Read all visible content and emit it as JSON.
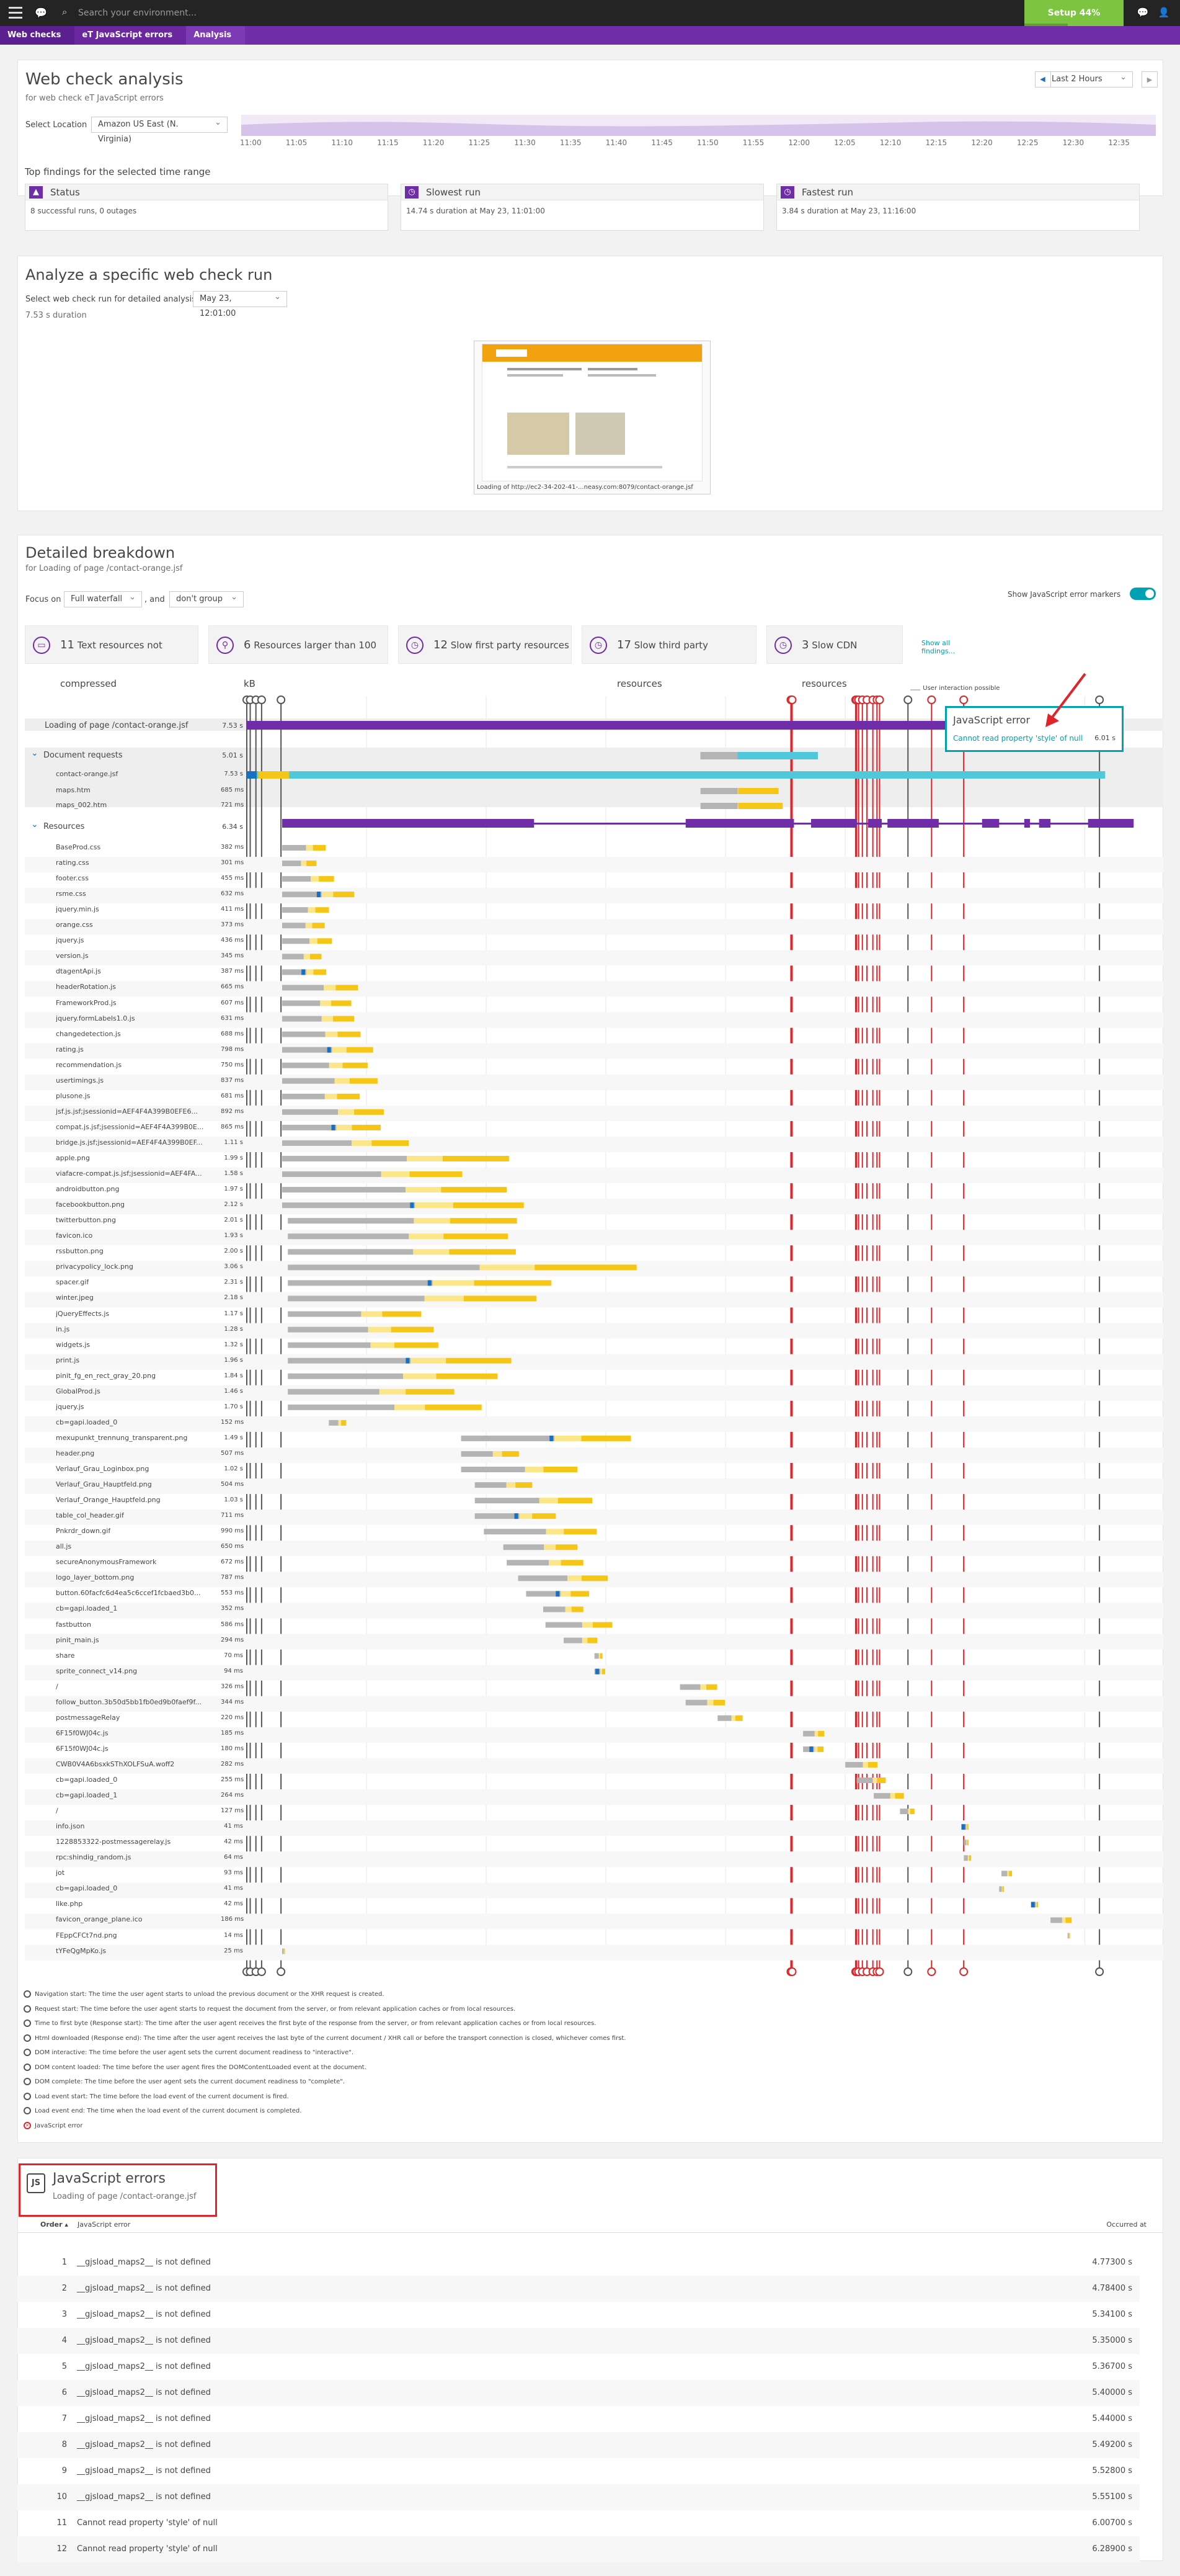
{
  "topbar": {
    "search_placeholder": "Search your environment...",
    "setup_label": "Setup 44% complete",
    "setup_progress": 0.44
  },
  "breadcrumb": [
    "Web checks",
    "eT JavaScript errors",
    "Analysis"
  ],
  "analysis": {
    "title": "Web check analysis",
    "subtitle": "for web check eT JavaScript errors",
    "location_label": "Select Location",
    "location_value": "Amazon US East (N. Virginia)",
    "timeframe": "Last 2 Hours",
    "ticks": [
      "11:00",
      "11:05",
      "11:10",
      "11:15",
      "11:20",
      "11:25",
      "11:30",
      "11:35",
      "11:40",
      "11:45",
      "11:50",
      "11:55",
      "12:00",
      "12:05",
      "12:10",
      "12:15",
      "12:20",
      "12:25",
      "12:30",
      "12:35"
    ]
  },
  "findings": {
    "title": "Top findings for the selected time range",
    "cards": [
      {
        "title": "Status",
        "body": "8 successful runs, 0 outages"
      },
      {
        "title": "Slowest run",
        "body": "14.74 s duration at May 23, 11:01:00"
      },
      {
        "title": "Fastest run",
        "body": "3.84 s duration at May 23, 11:16:00"
      }
    ]
  },
  "run": {
    "title": "Analyze a specific web check run",
    "select_label": "Select web check run for detailed analysis",
    "select_value": "May 23, 12:01:00",
    "duration": "7.53 s duration",
    "thumb_caption": "Loading of http://ec2-34-202-41-...neasy.com:8079/contact-orange.jsf"
  },
  "breakdown": {
    "title": "Detailed breakdown",
    "subtitle": "for Loading of page /contact-orange.jsf",
    "focus_label": "Focus on",
    "focus_value": "Full waterfall",
    "and_label": ", and",
    "group_value": "don't group",
    "show_js_markers": "Show JavaScript error markers",
    "chips": [
      {
        "count": "11",
        "text": "Text resources not compressed"
      },
      {
        "count": "6",
        "text": "Resources larger than 100 kB"
      },
      {
        "count": "12",
        "text": "Slow first party resources"
      },
      {
        "count": "17",
        "text": "Slow third party resources"
      },
      {
        "count": "3",
        "text": "Slow CDN resources"
      }
    ],
    "show_all": "Show all findings...",
    "user_interaction": "User interaction possible",
    "callout": {
      "title": "JavaScript error",
      "message": "Cannot read property 'style' of null",
      "time": "6.01 s"
    },
    "page_row": {
      "name": "Loading of page /contact-orange.jsf",
      "time": "7.53 s"
    },
    "doc_group": {
      "name": "Document requests",
      "time": "5.01 s"
    },
    "docs": [
      {
        "name": "contact-orange.jsf",
        "time": "7.53 s"
      },
      {
        "name": "maps.htm",
        "time": "685 ms"
      },
      {
        "name": "maps_002.htm",
        "time": "721 ms"
      }
    ],
    "res_group": {
      "name": "Resources",
      "time": "6.34 s"
    },
    "resources": [
      [
        "BaseProd.css",
        "382 ms"
      ],
      [
        "rating.css",
        "301 ms"
      ],
      [
        "footer.css",
        "455 ms"
      ],
      [
        "rsme.css",
        "632 ms"
      ],
      [
        "jquery.min.js",
        "411 ms"
      ],
      [
        "orange.css",
        "373 ms"
      ],
      [
        "jquery.js",
        "436 ms"
      ],
      [
        "version.js",
        "345 ms"
      ],
      [
        "dtagentApi.js",
        "387 ms"
      ],
      [
        "headerRotation.js",
        "665 ms"
      ],
      [
        "FrameworkProd.js",
        "607 ms"
      ],
      [
        "jquery.formLabels1.0.js",
        "631 ms"
      ],
      [
        "changedetection.js",
        "688 ms"
      ],
      [
        "rating.js",
        "798 ms"
      ],
      [
        "recommendation.js",
        "750 ms"
      ],
      [
        "usertimings.js",
        "837 ms"
      ],
      [
        "plusone.js",
        "681 ms"
      ],
      [
        "jsf.js.jsf;jsessionid=AEF4F4A399B0EFE6...",
        "892 ms"
      ],
      [
        "compat.js.jsf;jsessionid=AEF4F4A399B0E...",
        "865 ms"
      ],
      [
        "bridge.js.jsf;jsessionid=AEF4F4A399B0EF...",
        "1.11 s"
      ],
      [
        "apple.png",
        "1.99 s"
      ],
      [
        "viafacre-compat.js.jsf;jsessionid=AEF4FA...",
        "1.58 s"
      ],
      [
        "androidbutton.png",
        "1.97 s"
      ],
      [
        "facebookbutton.png",
        "2.12 s"
      ],
      [
        "twitterbutton.png",
        "2.01 s"
      ],
      [
        "favicon.ico",
        "1.93 s"
      ],
      [
        "rssbutton.png",
        "2.00 s"
      ],
      [
        "privacypolicy_lock.png",
        "3.06 s"
      ],
      [
        "spacer.gif",
        "2.31 s"
      ],
      [
        "winter.jpeg",
        "2.18 s"
      ],
      [
        "jQueryEffects.js",
        "1.17 s"
      ],
      [
        "in.js",
        "1.28 s"
      ],
      [
        "widgets.js",
        "1.32 s"
      ],
      [
        "print.js",
        "1.96 s"
      ],
      [
        "pinit_fg_en_rect_gray_20.png",
        "1.84 s"
      ],
      [
        "GlobalProd.js",
        "1.46 s"
      ],
      [
        "jquery.js",
        "1.70 s"
      ],
      [
        "cb=gapi.loaded_0",
        "152 ms"
      ],
      [
        "mexupunkt_trennung_transparent.png",
        "1.49 s"
      ],
      [
        "header.png",
        "507 ms"
      ],
      [
        "Verlauf_Grau_Loginbox.png",
        "1.02 s"
      ],
      [
        "Verlauf_Grau_Hauptfeld.png",
        "504 ms"
      ],
      [
        "Verlauf_Orange_Hauptfeld.png",
        "1.03 s"
      ],
      [
        "table_col_header.gif",
        "711 ms"
      ],
      [
        "Pnkrdr_down.gif",
        "990 ms"
      ],
      [
        "all.js",
        "650 ms"
      ],
      [
        "secureAnonymousFramework",
        "672 ms"
      ],
      [
        "logo_layer_bottom.png",
        "787 ms"
      ],
      [
        "button.60facfc6d4ea5c6ccef1fcbaed3b0...",
        "553 ms"
      ],
      [
        "cb=gapi.loaded_1",
        "352 ms"
      ],
      [
        "fastbutton",
        "586 ms"
      ],
      [
        "pinit_main.js",
        "294 ms"
      ],
      [
        "share",
        "70 ms"
      ],
      [
        "sprite_connect_v14.png",
        "94 ms"
      ],
      [
        "/",
        "326 ms"
      ],
      [
        "follow_button.3b50d5bb1fb0ed9b0faef9f...",
        "344 ms"
      ],
      [
        "postmessageRelay",
        "220 ms"
      ],
      [
        "6F15f0WJ04c.js",
        "185 ms"
      ],
      [
        "6F15f0WJ04c.js",
        "180 ms"
      ],
      [
        "CWB0V4A6bsxkSThXOLFSuA.woff2",
        "282 ms"
      ],
      [
        "cb=gapi.loaded_0",
        "255 ms"
      ],
      [
        "cb=gapi.loaded_1",
        "264 ms"
      ],
      [
        "/",
        "127 ms"
      ],
      [
        "info.json",
        "41 ms"
      ],
      [
        "1228853322-postmessagerelay.js",
        "42 ms"
      ],
      [
        "rpc:shindig_random.js",
        "64 ms"
      ],
      [
        "jot",
        "93 ms"
      ],
      [
        "cb=gapi.loaded_0",
        "41 ms"
      ],
      [
        "like.php",
        "42 ms"
      ],
      [
        "favicon_orange_plane.ico",
        "186 ms"
      ],
      [
        "FEppCFCt7nd.png",
        "14 ms"
      ],
      [
        "tYFeQgMpKo.js",
        "25 ms"
      ]
    ]
  },
  "legend": [
    "Navigation start: The time the user agent starts to unload the previous document or the XHR request is created.",
    "Request start: The time before the user agent starts to request the document from the server, or from relevant application caches or from local resources.",
    "Time to first byte (Response start): The time after the user agent receives the first byte of the response from the server, or from relevant application caches or from local resources.",
    "Html downloaded (Response end): The time after the user agent receives the last byte of the current document / XHR call or before the transport connection is closed, whichever comes first.",
    "DOM interactive: The time before the user agent sets the current document readiness to \"interactive\".",
    "DOM content loaded: The time before the user agent fires the DOMContentLoaded event at the document.",
    "DOM complete: The time before the user agent sets the current document readiness to \"complete\".",
    "Load event start: The time before the load event of the current document is fired.",
    "Load event end: The time when the load event of the current document is completed.",
    "JavaScript error"
  ],
  "jserrors": {
    "title": "JavaScript errors",
    "subtitle": "Loading of page /contact-orange.jsf",
    "col_order": "Order ▴",
    "col_error": "JavaScript error",
    "col_occurred": "Occurred at",
    "rows": [
      [
        "1",
        "__gjsload_maps2__ is not defined",
        "4.77300 s"
      ],
      [
        "2",
        "__gjsload_maps2__ is not defined",
        "4.78400 s"
      ],
      [
        "3",
        "__gjsload_maps2__ is not defined",
        "5.34100 s"
      ],
      [
        "4",
        "__gjsload_maps2__ is not defined",
        "5.35000 s"
      ],
      [
        "5",
        "__gjsload_maps2__ is not defined",
        "5.36700 s"
      ],
      [
        "6",
        "__gjsload_maps2__ is not defined",
        "5.40000 s"
      ],
      [
        "7",
        "__gjsload_maps2__ is not defined",
        "5.44000 s"
      ],
      [
        "8",
        "__gjsload_maps2__ is not defined",
        "5.49200 s"
      ],
      [
        "9",
        "__gjsload_maps2__ is not defined",
        "5.52800 s"
      ],
      [
        "10",
        "__gjsload_maps2__ is not defined",
        "5.55100 s"
      ],
      [
        "11",
        "Cannot read property 'style' of null",
        "6.00700 s"
      ],
      [
        "12",
        "Cannot read property 'style' of null",
        "6.28900 s"
      ]
    ]
  },
  "colors": {
    "purple": "#6f2da8",
    "teal": "#4fc9d9",
    "gray_bar": "#b4b4b4",
    "yellow": "#f5c518",
    "light_yellow": "#fbe68a",
    "blue": "#1770c2",
    "red": "#e0252a",
    "dark_gray": "#555555"
  }
}
